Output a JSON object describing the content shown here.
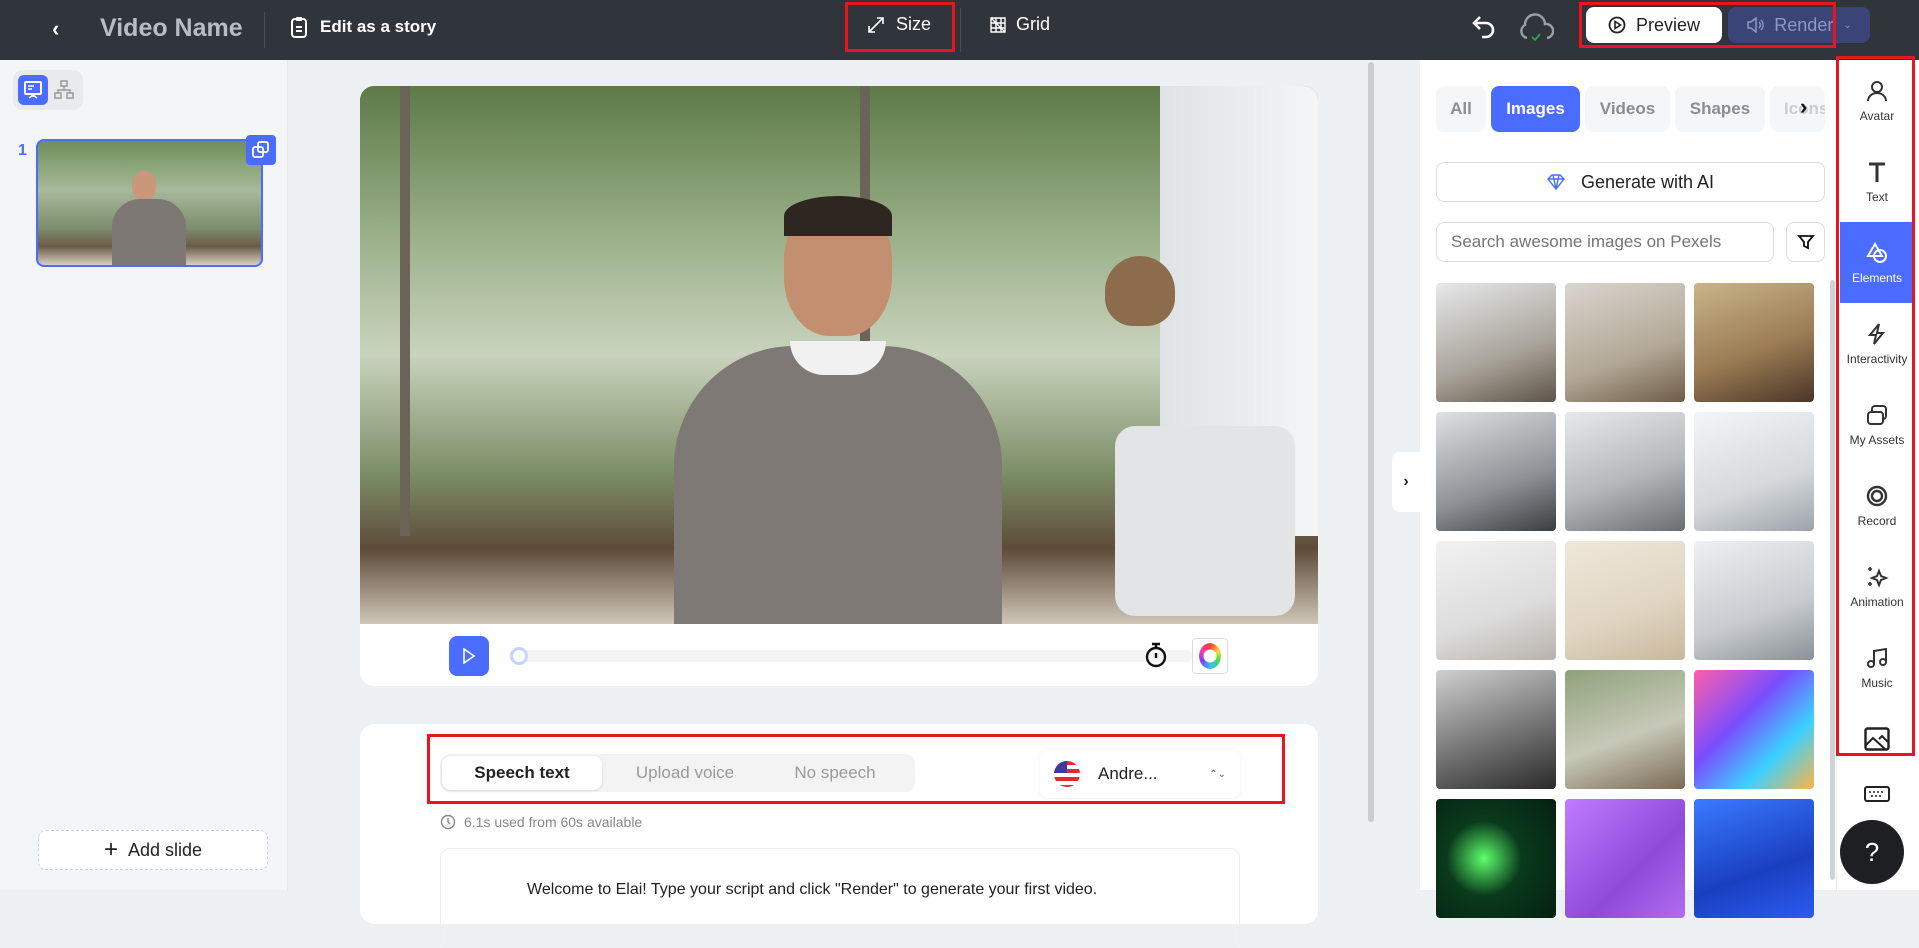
{
  "topbar": {
    "back": "‹",
    "video_name": "Video Name",
    "edit_story": "Edit as a story",
    "size": "Size",
    "grid": "Grid",
    "preview": "Preview",
    "render": "Render"
  },
  "left": {
    "slide_number": "1",
    "add_slide": "Add slide"
  },
  "speech": {
    "tabs": [
      "Speech text",
      "Upload voice",
      "No speech"
    ],
    "voice": "Andre...",
    "usage": "6.1s used from 60s available",
    "script": "Welcome to Elai! Type your script and click \"Render\" to generate your first video."
  },
  "video": {
    "progress": 0
  },
  "right": {
    "tabs": [
      "All",
      "Images",
      "Videos",
      "Shapes",
      "Icons"
    ],
    "active_tab": "Images",
    "generate": "Generate with AI",
    "search_placeholder": "Search awesome images on Pexels"
  },
  "rail": [
    {
      "label": "Avatar"
    },
    {
      "label": "Text"
    },
    {
      "label": "Elements"
    },
    {
      "label": "Interactivity"
    },
    {
      "label": "My Assets"
    },
    {
      "label": "Record"
    },
    {
      "label": "Animation"
    },
    {
      "label": "Music"
    }
  ],
  "help": "?",
  "colors": {
    "accent": "#4a6cff",
    "topbar": "#30343b",
    "highlight": "#e8141e"
  }
}
